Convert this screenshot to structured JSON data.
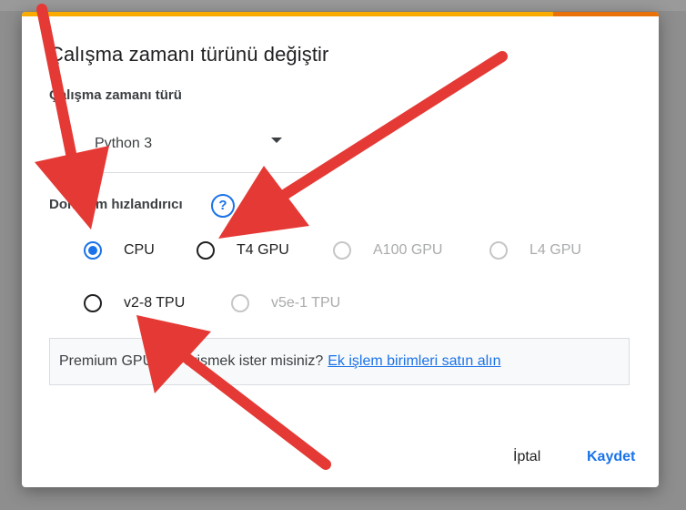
{
  "dialog": {
    "title": "Çalışma zamanı türünü değiştir",
    "runtime_type_label": "Çalışma zamanı türü",
    "runtime_type_value": "Python 3",
    "accelerator_label": "Donanım hızlandırıcı",
    "help_icon": "question-circle-icon",
    "accelerators": [
      {
        "label": "CPU",
        "selected": true,
        "enabled": true
      },
      {
        "label": "T4 GPU",
        "selected": false,
        "enabled": true
      },
      {
        "label": "A100 GPU",
        "selected": false,
        "enabled": false
      },
      {
        "label": "L4 GPU",
        "selected": false,
        "enabled": false
      },
      {
        "label": "v2-8 TPU",
        "selected": false,
        "enabled": true
      },
      {
        "label": "v5e-1 TPU",
        "selected": false,
        "enabled": false
      }
    ],
    "promo_text": "Premium GPU'lara erişmek ister misiniz?",
    "promo_link": "Ek işlem birimleri satın alın",
    "cancel_label": "İptal",
    "save_label": "Kaydet"
  },
  "colors": {
    "accent": "#1a73e8",
    "arrow": "#e53935",
    "progress": "#f9ab00"
  }
}
